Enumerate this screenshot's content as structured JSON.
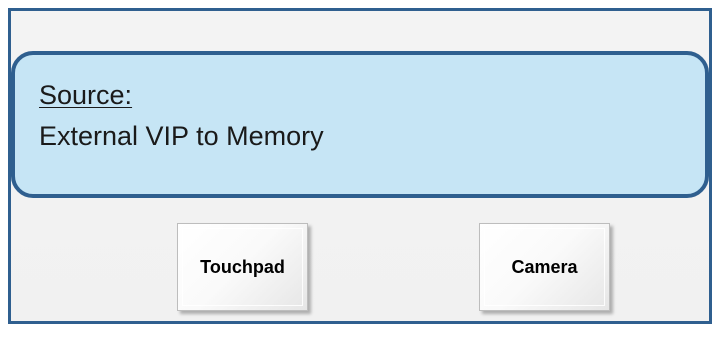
{
  "source_panel": {
    "label": "Source:",
    "value": "External VIP to Memory"
  },
  "buttons": {
    "touchpad_label": "Touchpad",
    "camera_label": "Camera"
  },
  "colors": {
    "frame_border": "#2f5f8f",
    "panel_fill": "#c6e5f5",
    "background": "#f2f2f2"
  }
}
